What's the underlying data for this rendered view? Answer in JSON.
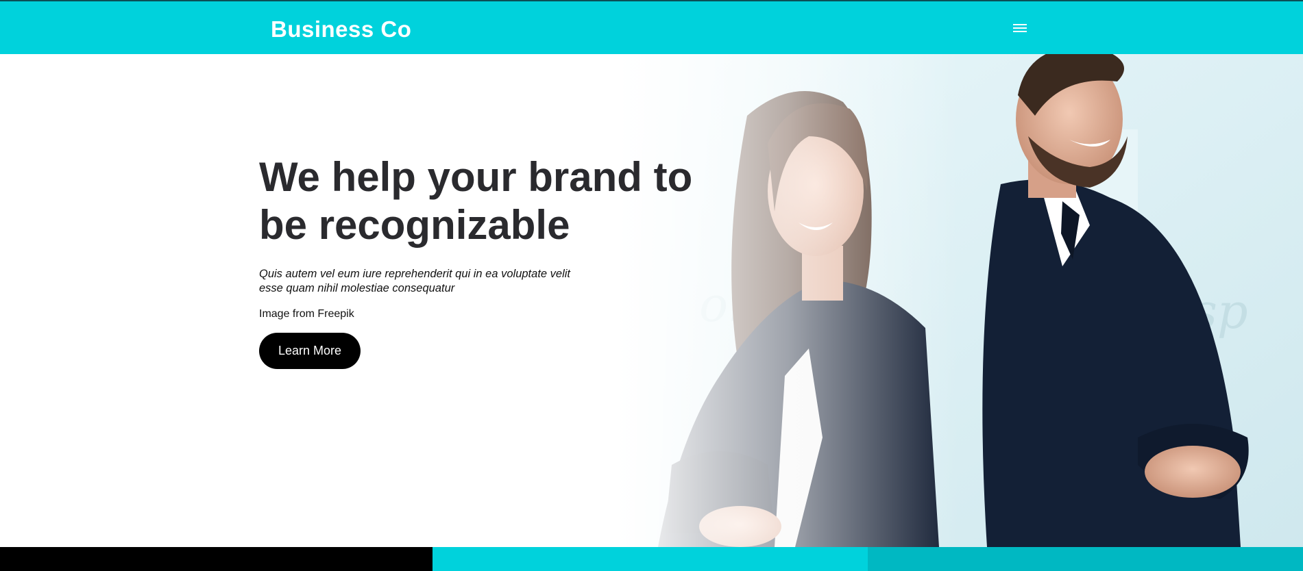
{
  "navbar": {
    "brand": "Business Co",
    "menu_icon": "hamburger-menu-icon",
    "color": "#00d2dc"
  },
  "hero": {
    "headline": "We help your brand to be recognizable",
    "subtext": "Quis autem vel eum iure reprehenderit qui in ea voluptate velit esse quam nihil molestiae consequatur",
    "image_credit": "Image from Freepik",
    "cta_label": "Learn More",
    "image_subject": "business-woman-and-man-photo"
  },
  "footer_bar": {
    "colors": [
      "#000000",
      "#00d2dc",
      "#00b8c2"
    ]
  }
}
